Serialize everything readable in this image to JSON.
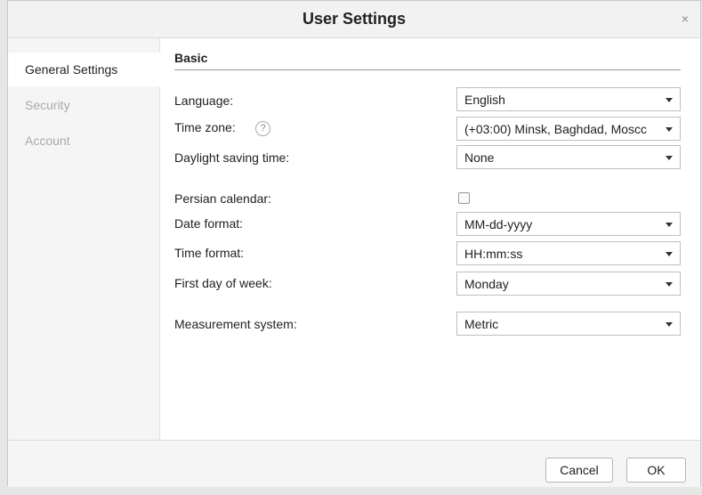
{
  "dialog": {
    "title": "User Settings",
    "close_glyph": "×"
  },
  "sidebar": {
    "items": [
      {
        "label": "General Settings",
        "active": true
      },
      {
        "label": "Security",
        "active": false
      },
      {
        "label": "Account",
        "active": false
      }
    ]
  },
  "basic": {
    "section_title": "Basic",
    "language": {
      "label": "Language:",
      "value": "English"
    },
    "time_zone": {
      "label": "Time zone:",
      "help_glyph": "?",
      "value": "(+03:00) Minsk, Baghdad, Moscc"
    },
    "daylight_saving": {
      "label": "Daylight saving time:",
      "value": "None"
    },
    "persian_calendar": {
      "label": "Persian calendar:",
      "checked": false
    },
    "date_format": {
      "label": "Date format:",
      "value": "MM-dd-yyyy"
    },
    "time_format": {
      "label": "Time format:",
      "value": "HH:mm:ss"
    },
    "first_day": {
      "label": "First day of week:",
      "value": "Monday"
    },
    "measurement": {
      "label": "Measurement system:",
      "value": "Metric"
    }
  },
  "footer": {
    "cancel_label": "Cancel",
    "ok_label": "OK"
  },
  "icons": {
    "close": "close-icon",
    "help": "help-icon",
    "dropdown": "chevron-down-icon"
  }
}
